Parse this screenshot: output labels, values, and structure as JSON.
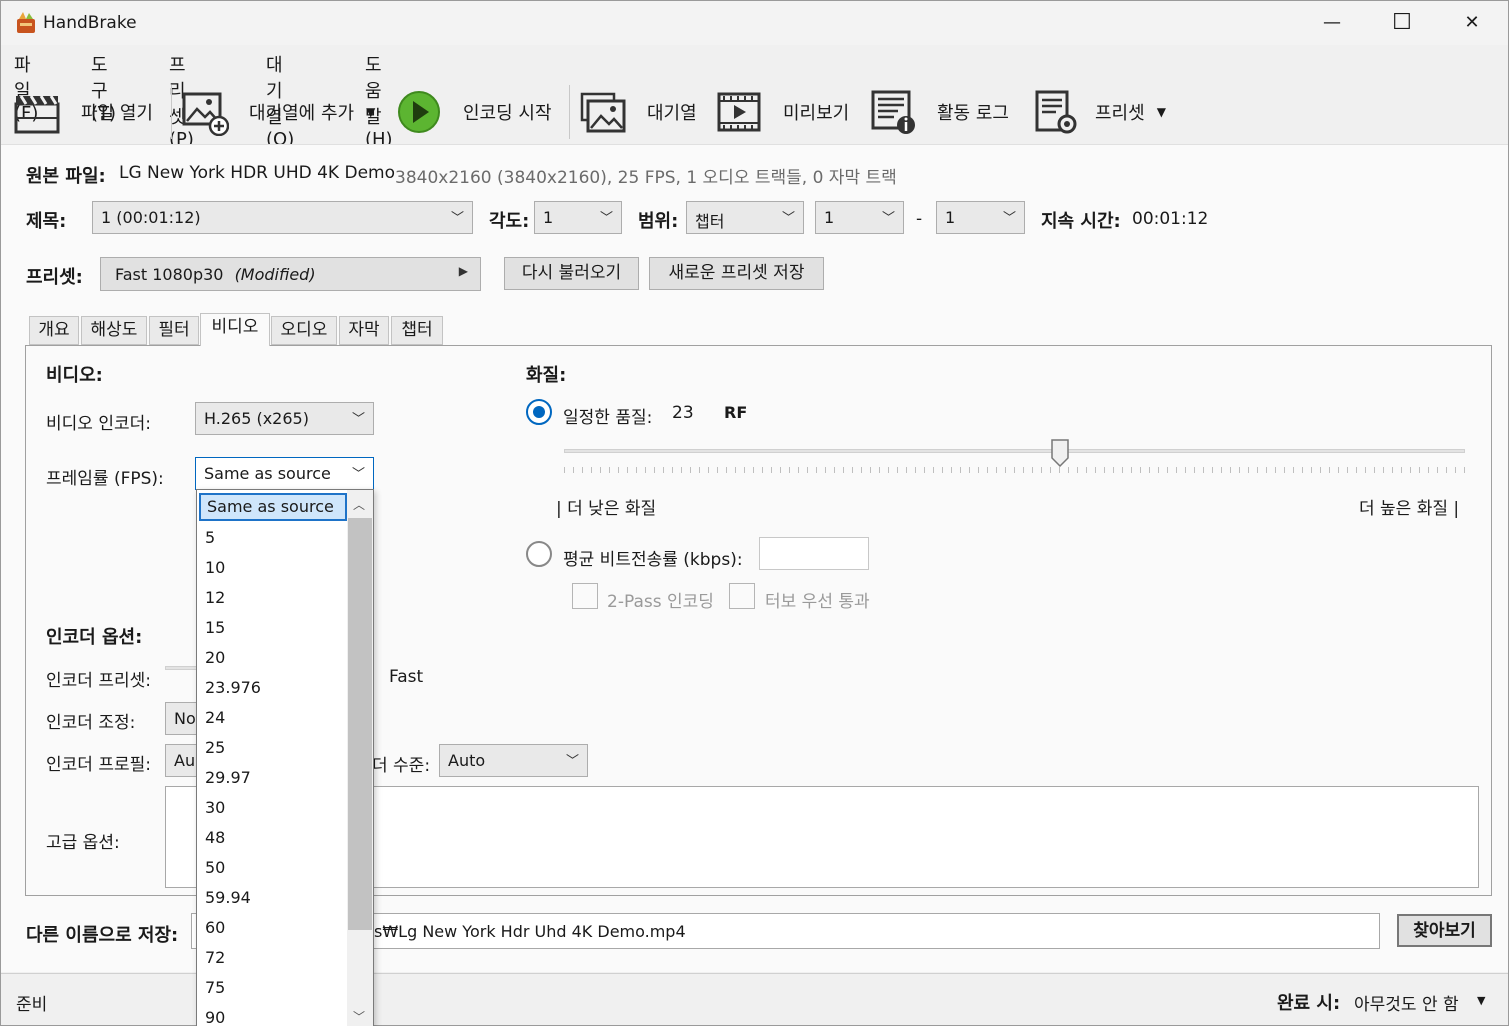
{
  "window": {
    "title": "HandBrake",
    "minimize": "—",
    "maximize": "☐",
    "close": "✕"
  },
  "menu": [
    "파일(F)",
    "도구(T)",
    "프리셋(P)",
    "대기열(Q)",
    "도움말(H)"
  ],
  "toolbar": {
    "open": "파일 열기",
    "add_queue": "대기열에 추가",
    "start": "인코딩 시작",
    "queue": "대기열",
    "preview": "미리보기",
    "log": "활동 로그",
    "presets": "프리셋",
    "dropdown_arrow": "▼"
  },
  "source": {
    "label": "원본 파일:",
    "name": "LG New York HDR UHD 4K Demo",
    "info": "3840x2160 (3840x2160), 25 FPS, 1 오디오 트랙들, 0 자막 트랙"
  },
  "title_row": {
    "title_label": "제목:",
    "title_value": "1  (00:01:12)",
    "angle_label": "각도:",
    "angle_value": "1",
    "range_label": "범위:",
    "range_type": "챕터",
    "range_start": "1",
    "range_dash": "-",
    "range_end": "1",
    "duration_label": "지속 시간:",
    "duration_value": "00:01:12"
  },
  "preset_row": {
    "label": "프리셋:",
    "value": "Fast 1080p30",
    "modified": "(Modified)",
    "arrow": "▶",
    "reload": "다시 불러오기",
    "save_new": "새로운 프리셋 저장"
  },
  "tabs": [
    "개요",
    "해상도",
    "필터",
    "비디오",
    "오디오",
    "자막",
    "챕터"
  ],
  "video": {
    "heading": "비디오:",
    "encoder_label": "비디오 인코더:",
    "encoder_value": "H.265 (x265)",
    "fps_label": "프레임률 (FPS):",
    "fps_value": "Same as source",
    "encoder_options_heading": "인코더 옵션:",
    "enc_preset_label": "인코더 프리셋:",
    "enc_preset_value": "Fast",
    "enc_tune_label": "인코더 조정:",
    "enc_tune_value": "No",
    "enc_profile_label": "인코더 프로필:",
    "enc_profile_value": "Au",
    "enc_level_label": "더 수준:",
    "enc_level_value": "Auto",
    "advanced_label": "고급 옵션:"
  },
  "quality": {
    "heading": "화질:",
    "constant_label": "일정한 품질:",
    "constant_value": "23",
    "rf": "RF",
    "lower": "| 더 낮은 화질",
    "higher": "더 높은 화질 |",
    "slider_fraction": 0.55,
    "avg_bitrate_label": "평균 비트전송률 (kbps):",
    "two_pass": "2-Pass 인코딩",
    "turbo": "터보 우선 통과"
  },
  "save_as": {
    "label": "다른 이름으로 저장:",
    "path_visible": "s₩Lg New York Hdr Uhd 4K Demo.mp4",
    "browse": "찾아보기"
  },
  "status": {
    "text": "준비",
    "when_done_label": "완료 시:",
    "when_done_value": "아무것도 안 함"
  },
  "fps_dropdown": {
    "items": [
      "Same as source",
      "5",
      "10",
      "12",
      "15",
      "20",
      "23.976",
      "24",
      "25",
      "29.97",
      "30",
      "48",
      "50",
      "59.94",
      "60",
      "72",
      "75",
      "90"
    ],
    "selected_index": 0
  },
  "colors": {
    "accent": "#0067c0",
    "selection": "#cfe6fb",
    "play_green": "#5cb531"
  }
}
